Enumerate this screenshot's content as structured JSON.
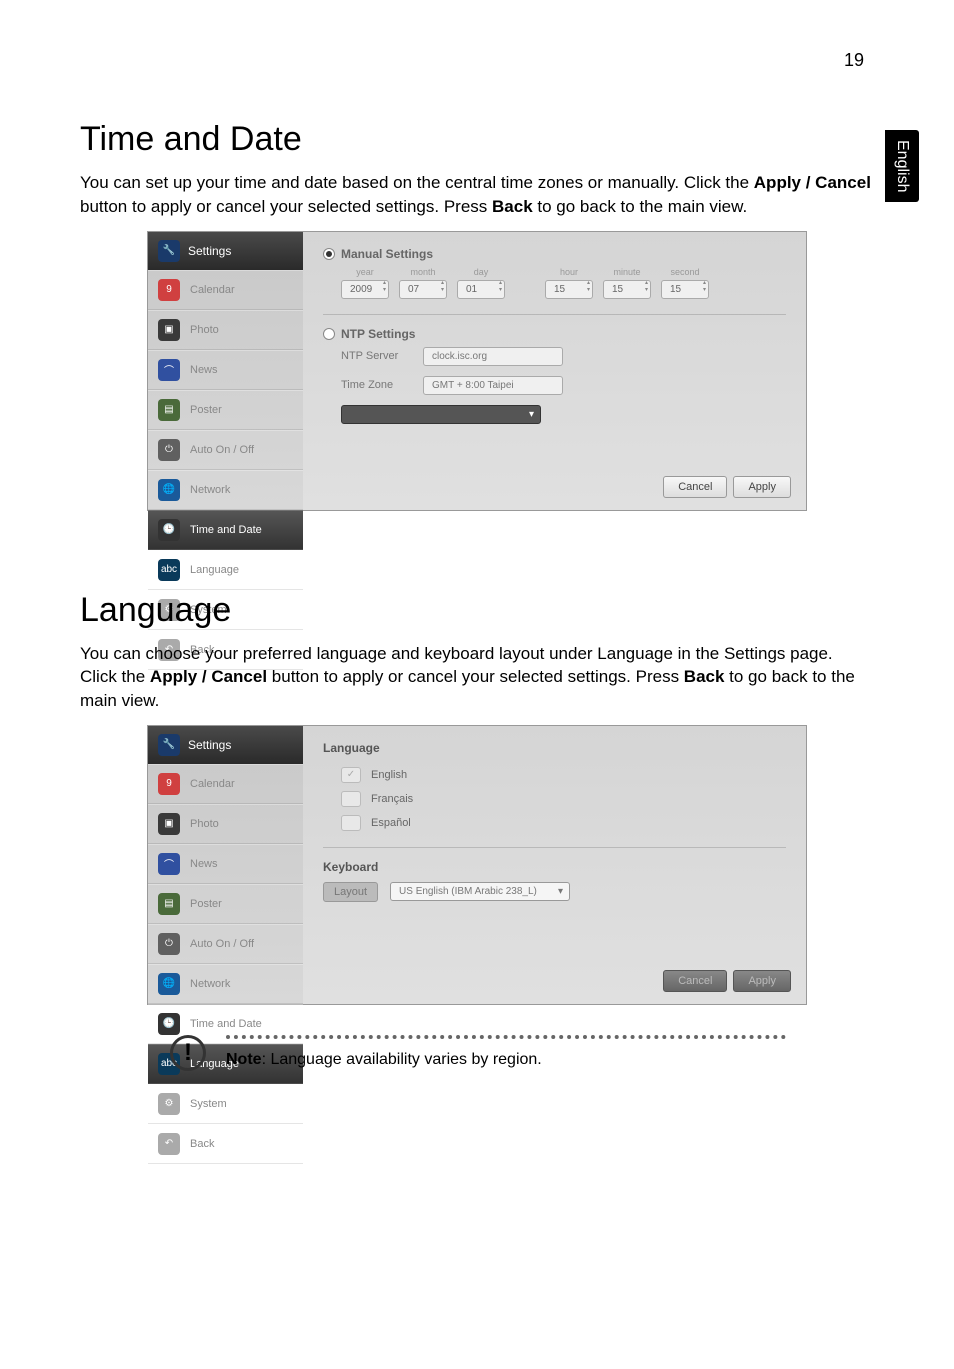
{
  "page_number": "19",
  "side_tab": "English",
  "section1": {
    "heading": "Time and Date",
    "intro": "You can set up your time and date based on the central time zones or manually. Click the Apply / Cancel button to apply or cancel your selected settings. Press Back to go back to the main view."
  },
  "section2": {
    "heading": "Language",
    "intro": "You can choose your preferred language and keyboard layout under Language in the Settings page. Click the Apply / Cancel button to apply or cancel your selected settings. Press Back to go back to the main view."
  },
  "note": {
    "prefix": "Note",
    "text": ": Language availability varies by region."
  },
  "sidebar": {
    "header": "Settings",
    "items": [
      {
        "label": "Calendar"
      },
      {
        "label": "Photo"
      },
      {
        "label": "News"
      },
      {
        "label": "Poster"
      },
      {
        "label": "Auto On / Off"
      },
      {
        "label": "Network"
      },
      {
        "label": "Time and Date"
      },
      {
        "label": "Language"
      },
      {
        "label": "System"
      },
      {
        "label": "Back"
      }
    ]
  },
  "time_panel": {
    "manual_label": "Manual Settings",
    "ntp_label": "NTP Settings",
    "labels": {
      "year": "year",
      "month": "month",
      "day": "day",
      "hour": "hour",
      "minute": "minute",
      "second": "second"
    },
    "values": {
      "year": "2009",
      "month": "07",
      "day": "01",
      "hour": "15",
      "minute": "15",
      "second": "15"
    },
    "ntp_server_label": "NTP Server",
    "ntp_server_value": "clock.isc.org",
    "tz_label": "Time Zone",
    "tz_value": "GMT + 8:00   Taipei",
    "cancel": "Cancel",
    "apply": "Apply"
  },
  "lang_panel": {
    "heading": "Language",
    "options": [
      "English",
      "Français",
      "Español"
    ],
    "keyboard_heading": "Keyboard",
    "layout_label": "Layout",
    "layout_value": "US English (IBM Arabic 238_L)",
    "cancel": "Cancel",
    "apply": "Apply"
  }
}
